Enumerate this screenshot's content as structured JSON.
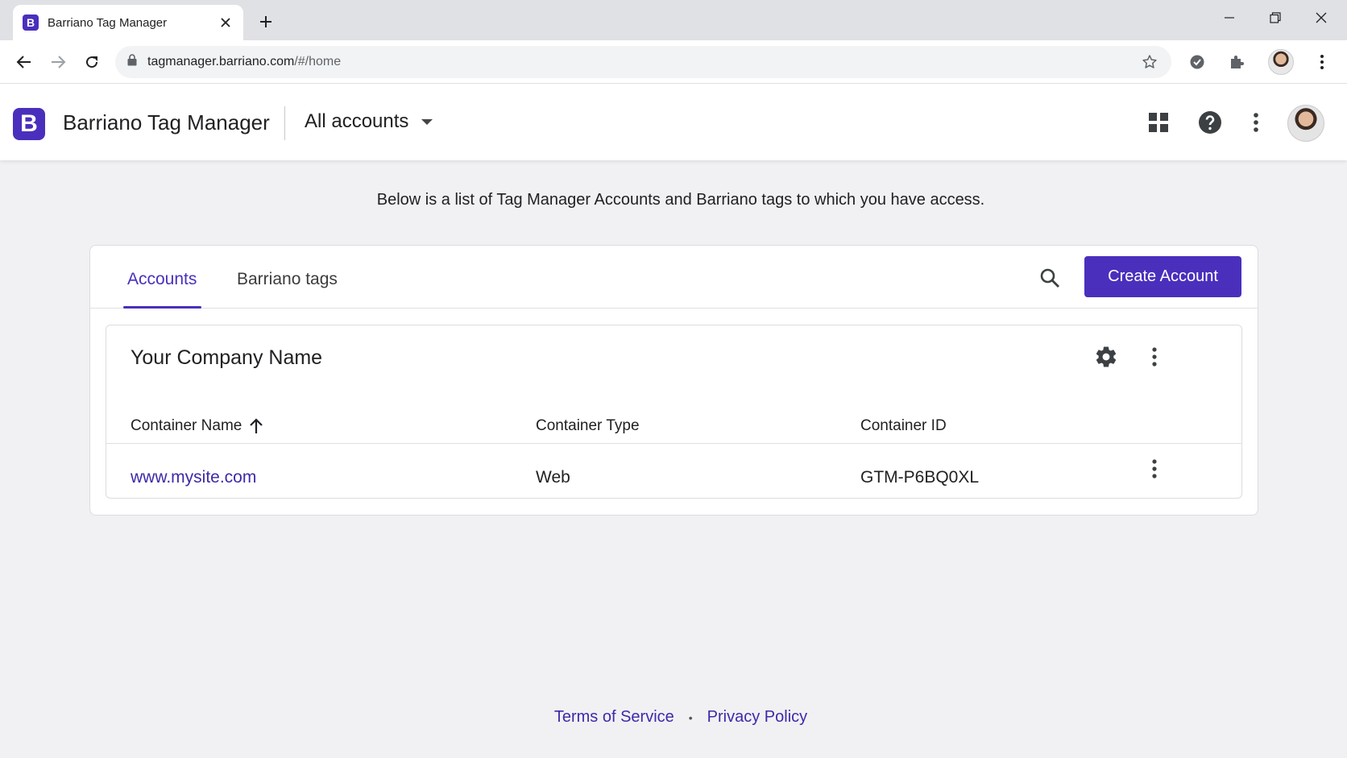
{
  "browser": {
    "tab_title": "Barriano Tag Manager",
    "favicon_letter": "B",
    "url_host": "tagmanager.barriano.com",
    "url_path": "/#/home"
  },
  "header": {
    "logo_letter": "B",
    "app_title": "Barriano Tag Manager",
    "account_selector": "All accounts"
  },
  "intro_text": "Below is a list of Tag Manager Accounts and Barriano tags to which you have access.",
  "tabs": [
    {
      "label": "Accounts",
      "active": true
    },
    {
      "label": "Barriano tags",
      "active": false
    }
  ],
  "create_button": "Create Account",
  "account": {
    "name": "Your Company Name",
    "columns": [
      "Container Name",
      "Container Type",
      "Container ID"
    ],
    "rows": [
      {
        "name": "www.mysite.com",
        "type": "Web",
        "id": "GTM-P6BQ0XL"
      }
    ]
  },
  "footer": {
    "terms": "Terms of Service",
    "privacy": "Privacy Policy"
  },
  "colors": {
    "brand": "#4a2fbd",
    "link": "#3d2aa8"
  }
}
